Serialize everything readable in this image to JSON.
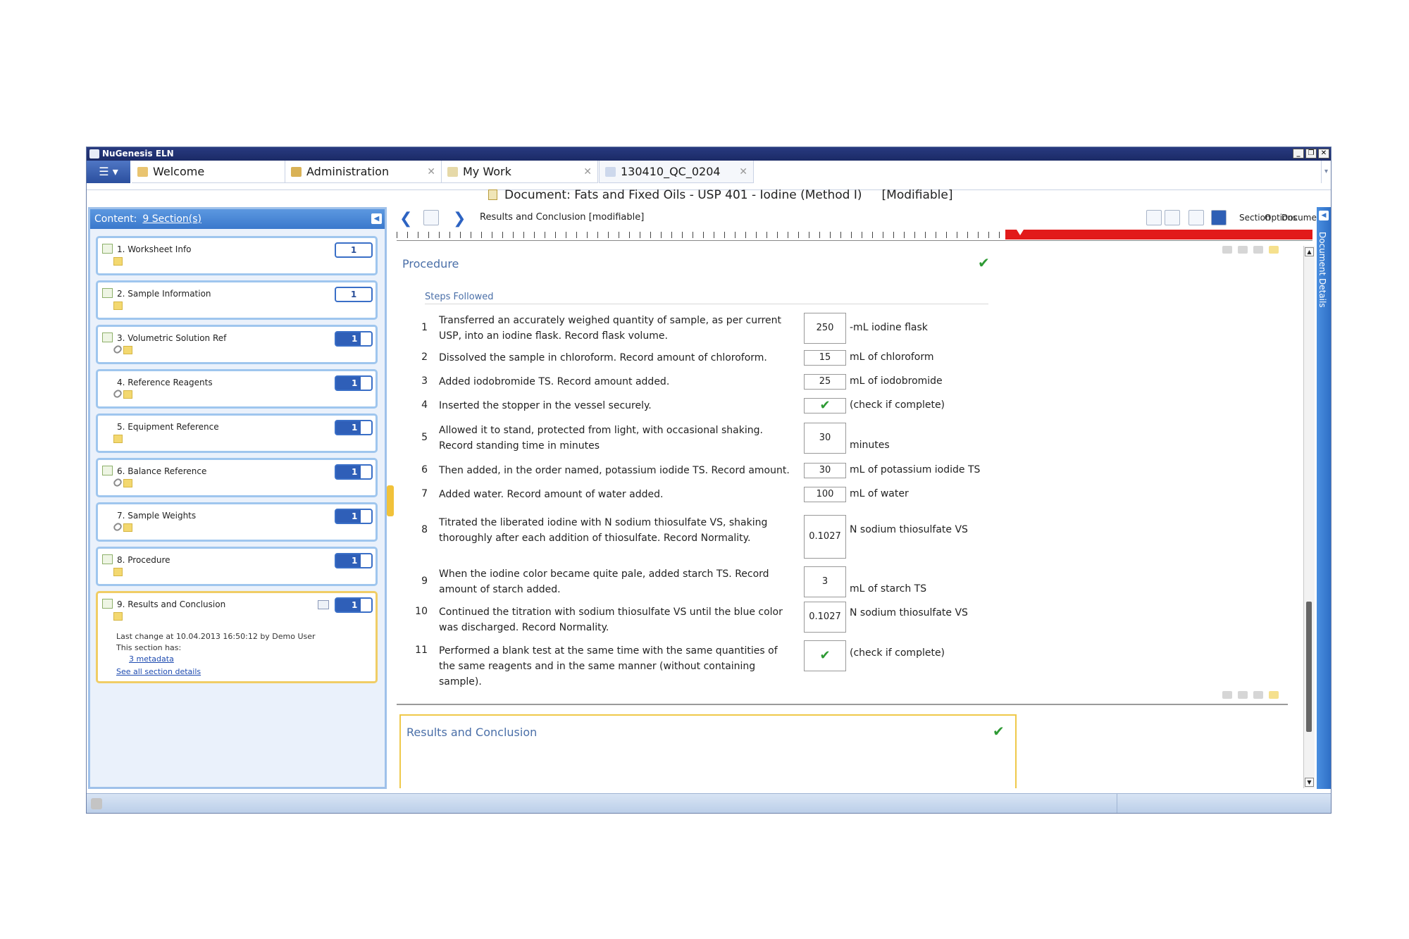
{
  "app": {
    "title": "NuGenesis ELN",
    "window_controls": [
      "_",
      "❐",
      "✕"
    ]
  },
  "tabs": [
    {
      "label": "Welcome",
      "icon": "home-icon"
    },
    {
      "label": "Administration",
      "icon": "admin-icon"
    },
    {
      "label": "My Work",
      "icon": "pin-icon"
    },
    {
      "label": "130410_QC_0204",
      "icon": "document-edit-icon"
    }
  ],
  "document": {
    "title": "Document: Fats and Fixed Oils - USP 401 - Iodine (Method I)",
    "status": "[Modifiable]"
  },
  "content_panel": {
    "label": "Content:",
    "sections_link": "9 Section(s)",
    "sections": [
      {
        "label": "1. Worksheet Info",
        "count": "1"
      },
      {
        "label": "2. Sample Information",
        "count": "1"
      },
      {
        "label": "3. Volumetric Solution Ref",
        "count": "1"
      },
      {
        "label": "4. Reference Reagents",
        "count": "1"
      },
      {
        "label": "5. Equipment Reference",
        "count": "1"
      },
      {
        "label": "6. Balance Reference",
        "count": "1"
      },
      {
        "label": "7. Sample Weights",
        "count": "1"
      },
      {
        "label": "8. Procedure",
        "count": "1"
      },
      {
        "label": "9. Results and Conclusion",
        "count": "1"
      }
    ],
    "active_details": {
      "last_change": "Last change at 10.04.2013 16:50:12 by Demo User",
      "has_label": "This section has:",
      "metadata_link": "3 metadata",
      "all_details_link": "See all section details"
    }
  },
  "toolbar": {
    "section_title": "Results and Conclusion [modifiable]",
    "menus": [
      "Section",
      "Document",
      "Options"
    ]
  },
  "right_rail": {
    "label": "Document Details"
  },
  "procedure": {
    "title": "Procedure",
    "steps_heading": "Steps Followed",
    "steps": [
      {
        "num": "1",
        "text": "Transferred an accurately weighed quantity of sample, as per current USP, into an iodine flask. Record flask volume.",
        "value": "250",
        "unit": "-mL iodine flask"
      },
      {
        "num": "2",
        "text": "Dissolved the sample in chloroform. Record amount of chloroform.",
        "value": "15",
        "unit": "mL of chloroform"
      },
      {
        "num": "3",
        "text": "Added iodobromide TS. Record amount added.",
        "value": "25",
        "unit": "mL of iodobromide"
      },
      {
        "num": "4",
        "text": "Inserted the stopper in the vessel securely.",
        "value": "✔",
        "unit": "(check if complete)"
      },
      {
        "num": "5",
        "text": "Allowed it to stand, protected from light, with occasional shaking. Record standing time in minutes",
        "value": "30",
        "unit": "minutes"
      },
      {
        "num": "6",
        "text": "Then added, in the order named, potassium iodide TS. Record amount.",
        "value": "30",
        "unit": "mL of potassium iodide TS"
      },
      {
        "num": "7",
        "text": "Added water. Record amount of water added.",
        "value": "100",
        "unit": "mL of water"
      },
      {
        "num": "8",
        "text": "Titrated the liberated iodine with N sodium thiosulfate VS, shaking thoroughly after each addition of thiosulfate. Record Normality.",
        "value": "0.1027",
        "unit": "N sodium thiosulfate VS"
      },
      {
        "num": "9",
        "text": "When the iodine color became quite pale, added starch TS. Record amount of starch added.",
        "value": "3",
        "unit": "mL of starch TS"
      },
      {
        "num": "10",
        "text": "Continued the titration with sodium thiosulfate VS until the blue color was discharged. Record Normality.",
        "value": "0.1027",
        "unit": "N sodium thiosulfate VS"
      },
      {
        "num": "11",
        "text": "Performed a blank test at the same time with the same quantities of the same reagents and in the same manner (without containing sample).",
        "value": "✔",
        "unit": "(check if complete)"
      }
    ]
  },
  "results": {
    "title": "Results and Conclusion"
  },
  "colors": {
    "accent": "#2f5fb8",
    "progress": "#e21a1a",
    "highlight": "#efc94a",
    "check": "#2e9a34"
  }
}
